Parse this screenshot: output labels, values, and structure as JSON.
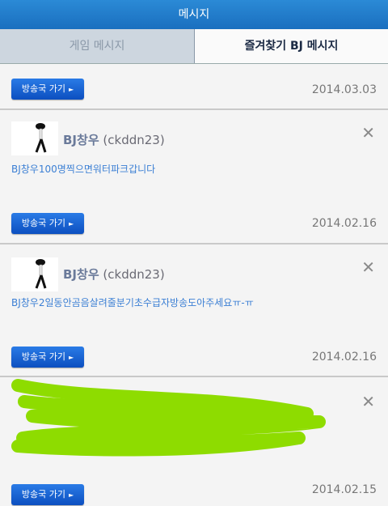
{
  "header": {
    "title": "메시지"
  },
  "tabs": [
    {
      "label": "게임 메시지",
      "active": false
    },
    {
      "label": "즐겨찾기 BJ 메시지",
      "active": true
    }
  ],
  "button_label": "방송국 가기",
  "messages": [
    {
      "date": "2014.03.03"
    },
    {
      "bj_name": "BJ창우",
      "bj_id": "(ckddn23)",
      "text": "BJ창우100명찍으면워터파크갑니다",
      "date": "2014.02.16"
    },
    {
      "bj_name": "BJ창우",
      "bj_id": "(ckddn23)",
      "text": "BJ창우2일동안곰음살려줄분기초수급자방송도아주세요ㅠ-ㅠ",
      "date": "2014.02.16"
    },
    {
      "date": "2014.02.15"
    }
  ],
  "colors": {
    "accent": "#1a6fbf",
    "button": "#0c4fc0",
    "message_text": "#3b7fd4",
    "scribble": "#8edc00"
  }
}
